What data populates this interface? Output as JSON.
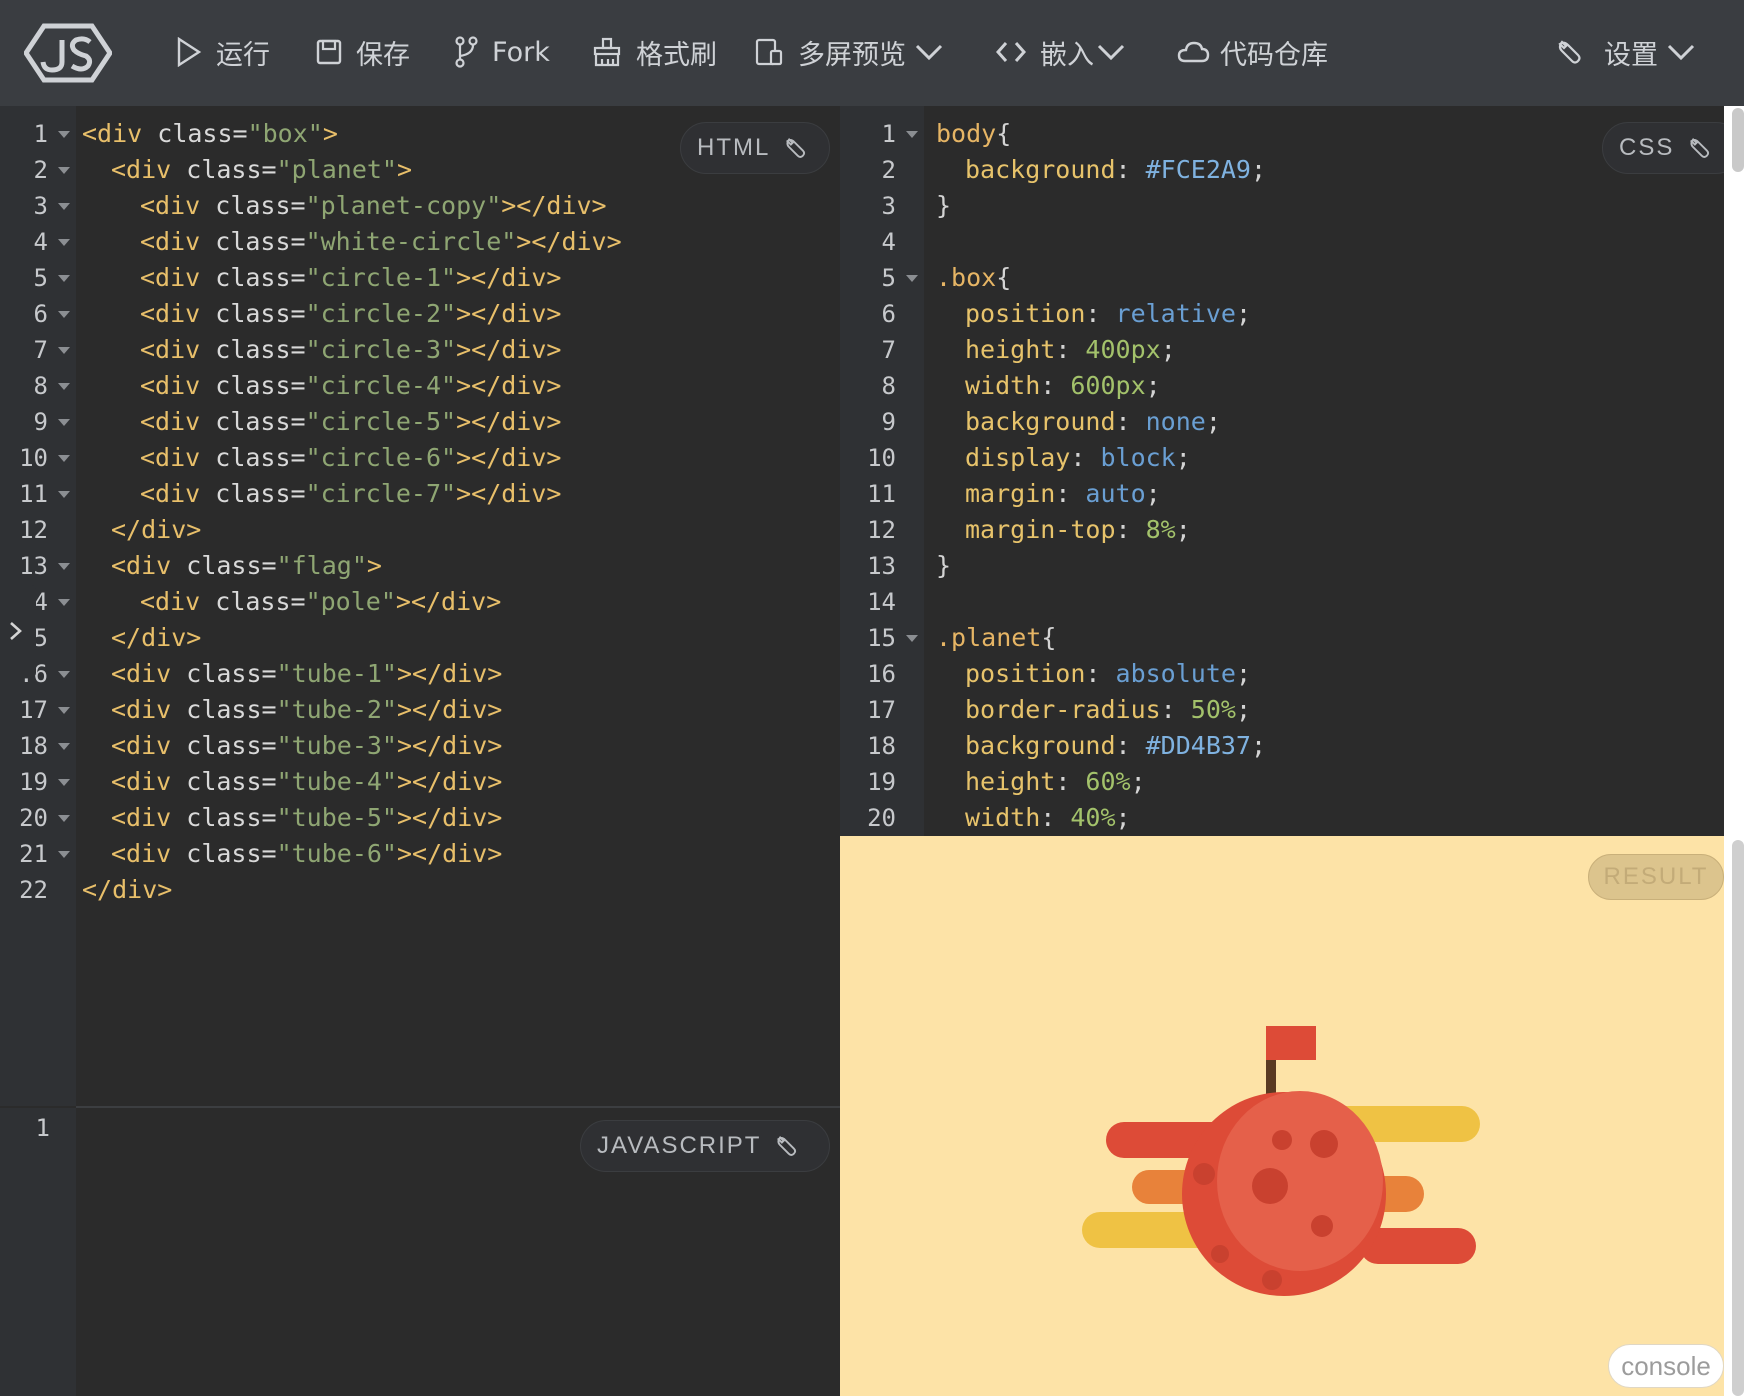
{
  "toolbar": {
    "run": "运行",
    "save": "保存",
    "fork": "Fork",
    "format": "格式刷",
    "preview": "多屏预览",
    "embed": "嵌入",
    "repo": "代码仓库",
    "settings": "设置"
  },
  "html_panel": {
    "badge": "HTML",
    "lines": [
      "1",
      "2",
      "3",
      "4",
      "5",
      "6",
      "7",
      "8",
      "9",
      "10",
      "11",
      "12",
      "13",
      "4",
      "5",
      ".6",
      "17",
      "18",
      "19",
      "20",
      "21",
      "22"
    ]
  },
  "css_panel": {
    "badge": "CSS",
    "lines": [
      "1",
      "2",
      "3",
      "4",
      "5",
      "6",
      "7",
      "8",
      "9",
      "10",
      "11",
      "12",
      "13",
      "14",
      "15",
      "16",
      "17",
      "18",
      "19",
      "20"
    ]
  },
  "js_panel": {
    "badge": "JAVASCRIPT",
    "lines": [
      "1"
    ]
  },
  "html_code": {
    "l1_tag": "<div ",
    "l1_attr": "class=",
    "l1_str": "\"box\"",
    "l1_end": ">",
    "l2_tag": "<div ",
    "l2_attr": "class=",
    "l2_str": "\"planet\"",
    "l2_end": ">",
    "l3_tag": "<div ",
    "l3_attr": "class=",
    "l3_str": "\"planet-copy\"",
    "l3_end": "></div>",
    "l4_tag": "<div ",
    "l4_attr": "class=",
    "l4_str": "\"white-circle\"",
    "l4_end": "></div>",
    "l5_tag": "<div ",
    "l5_attr": "class=",
    "l5_str": "\"circle-1\"",
    "l5_end": "></div>",
    "l6_tag": "<div ",
    "l6_attr": "class=",
    "l6_str": "\"circle-2\"",
    "l6_end": "></div>",
    "l7_tag": "<div ",
    "l7_attr": "class=",
    "l7_str": "\"circle-3\"",
    "l7_end": "></div>",
    "l8_tag": "<div ",
    "l8_attr": "class=",
    "l8_str": "\"circle-4\"",
    "l8_end": "></div>",
    "l9_tag": "<div ",
    "l9_attr": "class=",
    "l9_str": "\"circle-5\"",
    "l9_end": "></div>",
    "l10_tag": "<div ",
    "l10_attr": "class=",
    "l10_str": "\"circle-6\"",
    "l10_end": "></div>",
    "l11_tag": "<div ",
    "l11_attr": "class=",
    "l11_str": "\"circle-7\"",
    "l11_end": "></div>",
    "l12_tag": "</div>",
    "l13_tag": "<div ",
    "l13_attr": "class=",
    "l13_str": "\"flag\"",
    "l13_end": ">",
    "l14_tag": "<div ",
    "l14_attr": "class=",
    "l14_str": "\"pole\"",
    "l14_end": "></div>",
    "l15_tag": "</div>",
    "l16_tag": "<div ",
    "l16_attr": "class=",
    "l16_str": "\"tube-1\"",
    "l16_end": "></div>",
    "l17_tag": "<div ",
    "l17_attr": "class=",
    "l17_str": "\"tube-2\"",
    "l17_end": "></div>",
    "l18_tag": "<div ",
    "l18_attr": "class=",
    "l18_str": "\"tube-3\"",
    "l18_end": "></div>",
    "l19_tag": "<div ",
    "l19_attr": "class=",
    "l19_str": "\"tube-4\"",
    "l19_end": "></div>",
    "l20_tag": "<div ",
    "l20_attr": "class=",
    "l20_str": "\"tube-5\"",
    "l20_end": "></div>",
    "l21_tag": "<div ",
    "l21_attr": "class=",
    "l21_str": "\"tube-6\"",
    "l21_end": "></div>",
    "l22_tag": "</div>"
  },
  "css_code": {
    "l1_sel": "body",
    "l1_p": "{",
    "l2_prop": "background",
    "l2_c": ": ",
    "l2_val": "#FCE2A9",
    "l2_e": ";",
    "l3_p": "}",
    "l5_sel": ".box",
    "l5_p": "{",
    "l6_prop": "position",
    "l6_c": ": ",
    "l6_val": "relative",
    "l6_e": ";",
    "l7_prop": "height",
    "l7_c": ": ",
    "l7_val": "400px",
    "l7_e": ";",
    "l8_prop": "width",
    "l8_c": ": ",
    "l8_val": "600px",
    "l8_e": ";",
    "l9_prop": "background",
    "l9_c": ": ",
    "l9_val": "none",
    "l9_e": ";",
    "l10_prop": "display",
    "l10_c": ": ",
    "l10_val": "block",
    "l10_e": ";",
    "l11_prop": "margin",
    "l11_c": ": ",
    "l11_val": "auto",
    "l11_e": ";",
    "l12_prop": "margin-top",
    "l12_c": ": ",
    "l12_val": "8%",
    "l12_e": ";",
    "l13_p": "}",
    "l15_sel": ".planet",
    "l15_p": "{",
    "l16_prop": "position",
    "l16_c": ": ",
    "l16_val": "absolute",
    "l16_e": ";",
    "l17_prop": "border-radius",
    "l17_c": ": ",
    "l17_val": "50%",
    "l17_e": ";",
    "l18_prop": "background",
    "l18_c": ": ",
    "l18_val": "#DD4B37",
    "l18_e": ";",
    "l19_prop": "height",
    "l19_c": ": ",
    "l19_val": "60%",
    "l19_e": ";",
    "l20_prop": "width",
    "l20_c": ": ",
    "l20_val": "40%",
    "l20_e": ";"
  },
  "result": {
    "badge": "RESULT",
    "console": "console"
  },
  "colors": {
    "result_bg": "#FCE2A9",
    "planet": "#DD4B37",
    "planet_highlight": "#E5604A",
    "crater": "#C9412F",
    "flag": "#DD4B37",
    "pole": "#5A3A22",
    "tube_red": "#DD4B37",
    "tube_orange": "#E8823A",
    "tube_yellow": "#EFC244"
  },
  "icons": {
    "logo": "js-logo-icon",
    "run": "play-icon",
    "save": "floppy-icon",
    "fork": "fork-icon",
    "format": "brush-icon",
    "preview": "devices-icon",
    "embed": "code-icon",
    "repo": "cloud-icon",
    "settings": "wrench-icon"
  }
}
